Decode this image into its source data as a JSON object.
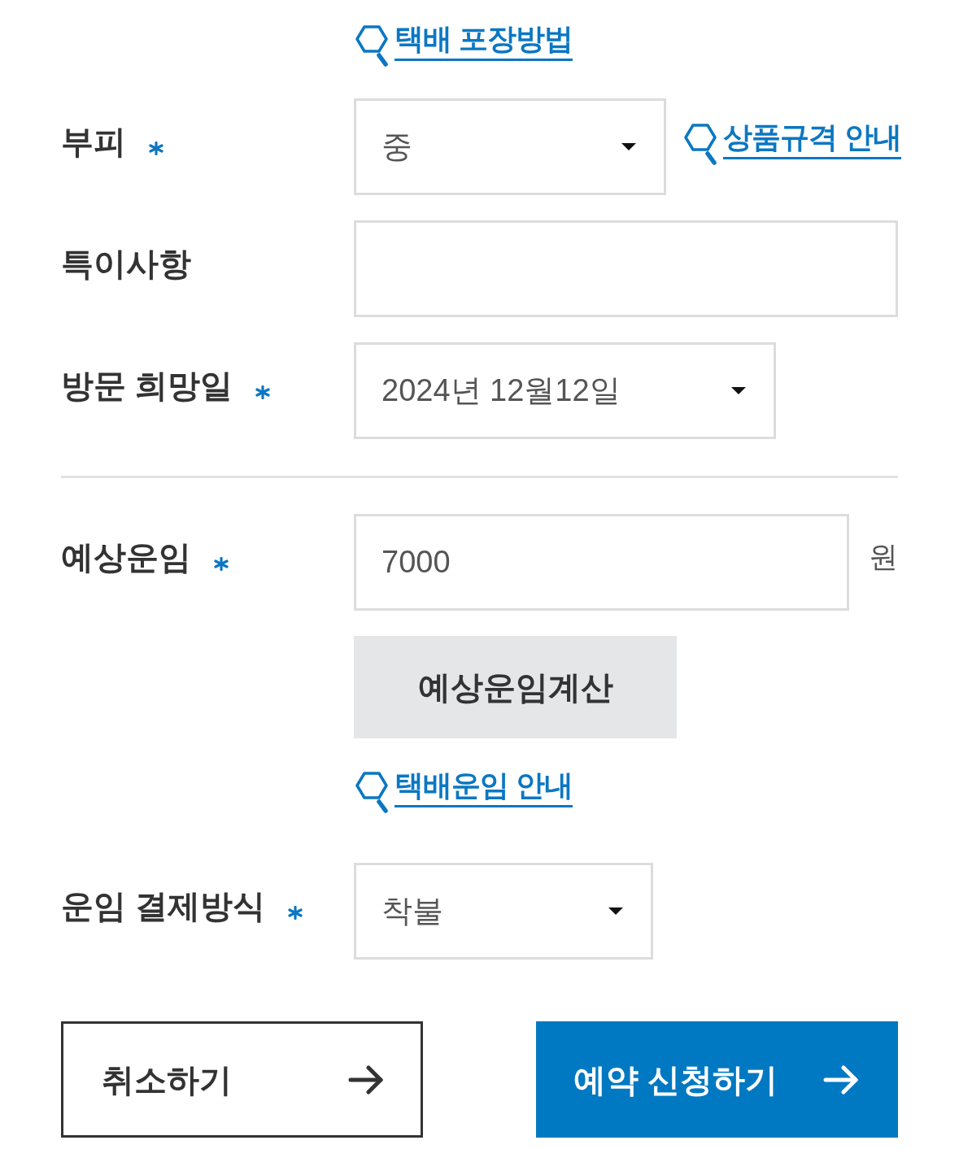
{
  "packing_guide_link": "택배 포장방법",
  "rows": [
    {
      "kind": "select",
      "label": "부피",
      "required": true,
      "value": "중",
      "link": "상품규격 안내"
    },
    {
      "kind": "text",
      "label": "특이사항",
      "required": false
    },
    {
      "kind": "select",
      "label": "방문 희망일",
      "required": true,
      "value": "2024년 12월12일"
    }
  ],
  "fare": {
    "label": "예상운임",
    "required": true,
    "value": "7000",
    "unit": "원",
    "calc_button": "예상운임계산",
    "guide_link": "택배운임 안내"
  },
  "payment": {
    "kind": "select",
    "label": "운임 결제방식",
    "required": true,
    "value": "착불"
  },
  "buttons": [
    {
      "kind": "secondary",
      "label": "취소하기"
    },
    {
      "kind": "primary",
      "label": "예약 신청하기"
    }
  ]
}
